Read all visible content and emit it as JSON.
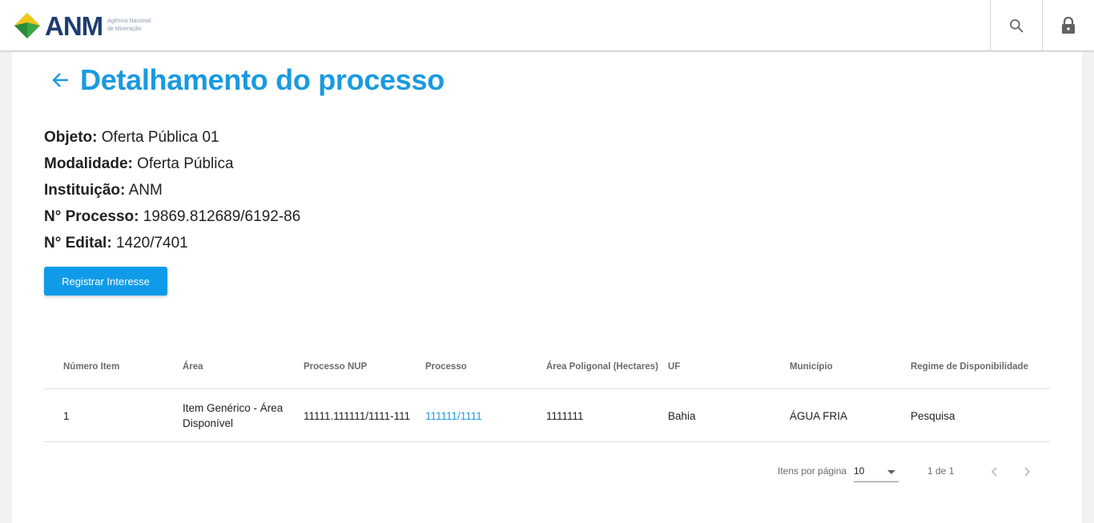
{
  "header": {
    "brand": "ANM",
    "brand_sub": "Agência Nacional de Mineração",
    "icons": {
      "search": "search-icon",
      "lock": "lock-icon"
    }
  },
  "page": {
    "title": "Detalhamento do processo",
    "back_icon": "arrow-back-icon"
  },
  "info": [
    {
      "label": "Objeto:",
      "value": "Oferta Pública 01"
    },
    {
      "label": "Modalidade:",
      "value": "Oferta Pública"
    },
    {
      "label": "Instituição:",
      "value": "ANM"
    },
    {
      "label": "N° Processo:",
      "value": "19869.812689/6192-86"
    },
    {
      "label": "N° Edital:",
      "value": "1420/7401"
    }
  ],
  "actions": {
    "register_label": "Registrar Interesse"
  },
  "table": {
    "columns": [
      "Número Item",
      "Área",
      "Processo NUP",
      "Processo",
      "Área Poligonal (Hectares)",
      "UF",
      "Município",
      "Regime de Disponibilidade"
    ],
    "rows": [
      [
        "1",
        "Item Genérico - Área Disponível",
        "11111.111111/1111-111",
        "111111/1111",
        "1111111",
        "Bahia",
        "ÁGUA FRIA",
        "Pesquisa"
      ]
    ]
  },
  "paginator": {
    "items_per_page_label": "Itens por página",
    "page_size": "10",
    "range_label": "1 de 1"
  },
  "colors": {
    "accent": "#1a9ae0",
    "button": "#0f9be8",
    "brand_navy": "#1f3c6e",
    "brand_green": "#3aa645",
    "brand_yellow": "#f5c518"
  }
}
